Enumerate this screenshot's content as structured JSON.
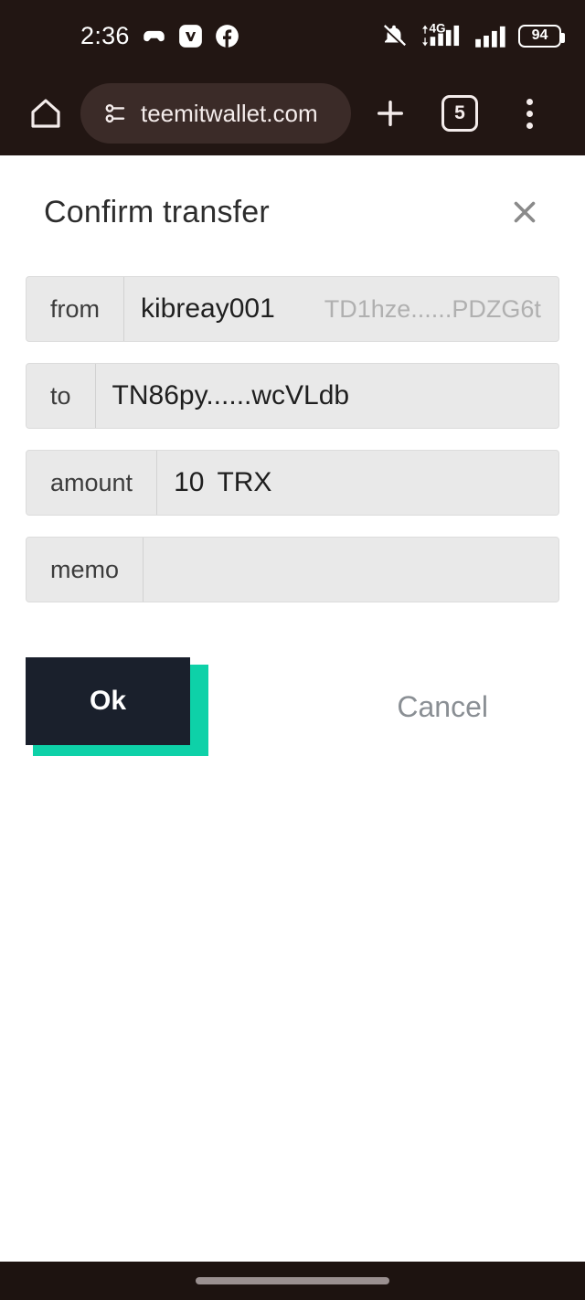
{
  "status_bar": {
    "time": "2:36",
    "app_icons": [
      "game-controller-icon",
      "vimeo-icon",
      "facebook-icon"
    ],
    "mute_icon": "bell-muted-icon",
    "network_label": "4G",
    "signal_icon": "signal-bars-icon",
    "signal_icon_2": "signal-bars-icon",
    "battery_level": "94"
  },
  "browser": {
    "home_icon": "home-icon",
    "site_info_icon": "page-settings-icon",
    "url": "teemitwallet.com",
    "new_tab_icon": "plus-icon",
    "tab_count": "5",
    "menu_icon": "kebab-menu-icon"
  },
  "dialog": {
    "title": "Confirm transfer",
    "close_icon": "close-icon",
    "fields": [
      {
        "label": "from",
        "value": "kibreay001",
        "secondary": "TD1hze......PDZG6t"
      },
      {
        "label": "to",
        "value": "TN86py......wcVLdb",
        "secondary": ""
      },
      {
        "label": "amount",
        "value": "10",
        "secondary": "TRX"
      },
      {
        "label": "memo",
        "value": "",
        "secondary": ""
      }
    ],
    "ok_label": "Ok",
    "cancel_label": "Cancel"
  },
  "colors": {
    "chrome_bg": "#221613",
    "url_pill": "#3b2b28",
    "accent_teal": "#0ed1a8",
    "button_dark": "#1a202c",
    "field_bg": "#e9e9e9"
  },
  "navigation_bar": {
    "gesture_pill": "home-gesture-pill"
  }
}
